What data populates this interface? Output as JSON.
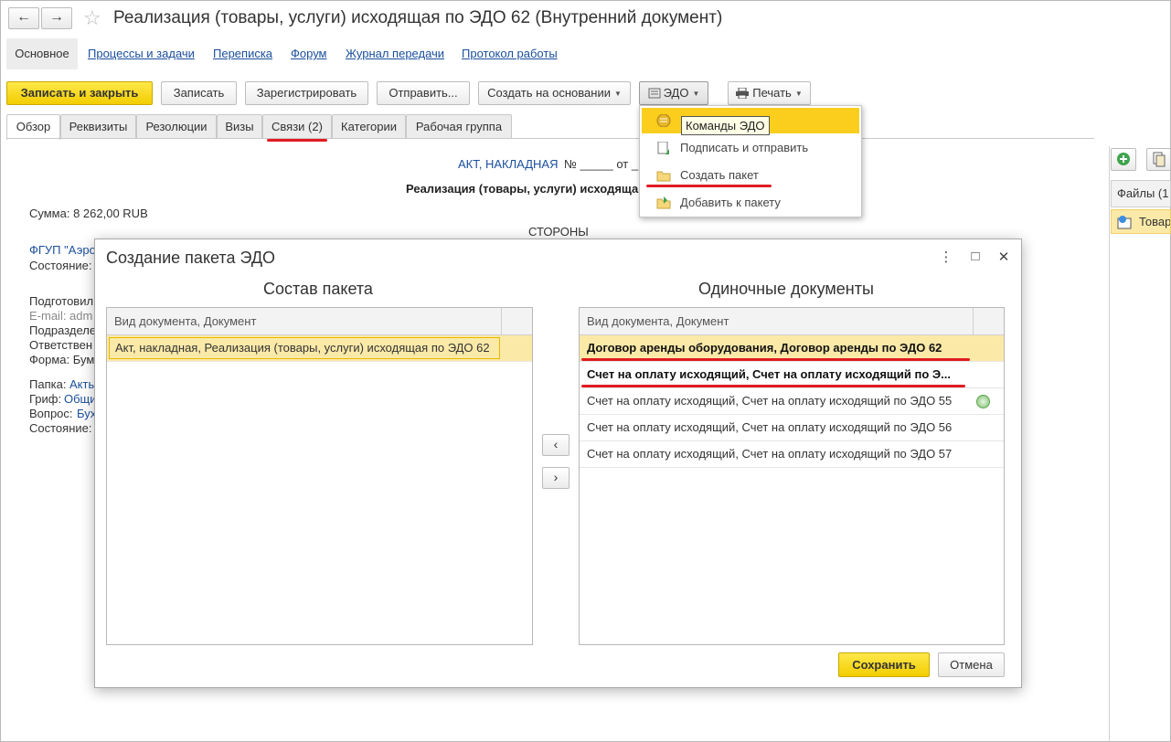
{
  "window": {
    "title": "Реализация (товары, услуги) исходящая по ЭДО 62 (Внутренний документ)",
    "back_icon": "←",
    "forward_icon": "→",
    "star_icon": "☆"
  },
  "sections": [
    "Основное",
    "Процессы и задачи",
    "Переписка",
    "Форум",
    "Журнал передачи",
    "Протокол работы"
  ],
  "toolbar": {
    "save_close": "Записать и закрыть",
    "save": "Записать",
    "register": "Зарегистрировать",
    "send": "Отправить...",
    "create_based": "Создать на основании",
    "edo": "ЭДО",
    "print": "Печать"
  },
  "tabs": [
    "Обзор",
    "Реквизиты",
    "Резолюции",
    "Визы",
    "Связи (2)",
    "Категории",
    "Рабочая группа"
  ],
  "edo_menu": {
    "items": [
      "Команды ЭДО",
      "Подписать и отправить",
      "Создать пакет",
      "Добавить к пакету"
    ],
    "tooltip": "Команды ЭДО"
  },
  "document": {
    "act_link": "АКТ, НАКЛАДНАЯ",
    "number_label": "№ _____ от _",
    "doc_name": "Реализация (товары, услуги) исходяща",
    "sum": "Сумма: 8 262,00 RUB",
    "parties_header": "СТОРОНЫ",
    "org_link": "ФГУП \"Аэро",
    "state_label": "Состояние: З",
    "prepared_label": "Подготовил",
    "email_label": "E-mail: adm",
    "department_label": "Подразделе",
    "responsible_label": "Ответствен",
    "form_label": "Форма: Бум",
    "folder_label": "Папка:",
    "folder_value": "Акты",
    "stamp_label": "Гриф:",
    "stamp_value": "Общи",
    "question_label": "Вопрос:",
    "question_value": "Бух",
    "status_label": "Состояние:"
  },
  "right_pane": {
    "files_header": "Файлы (1",
    "file_name": "Товар"
  },
  "dialog": {
    "title": "Создание пакета ЭДО",
    "menu_icon": "⋮",
    "maximize_icon": "□",
    "close_icon": "✕",
    "left_title": "Состав пакета",
    "right_title": "Одиночные документы",
    "column_header": "Вид документа, Документ",
    "package_rows": [
      "Акт, накладная, Реализация (товары, услуги) исходящая по ЭДО 62"
    ],
    "single_rows": [
      "Договор аренды оборудования, Договор аренды по ЭДО 62",
      "Счет на оплату исходящий, Счет на оплату исходящий по Э...",
      "Счет на оплату исходящий, Счет на оплату исходящий по ЭДО 55",
      "Счет на оплату исходящий, Счет на оплату исходящий по ЭДО 56",
      "Счет на оплату исходящий, Счет на оплату исходящий по ЭДО 57"
    ],
    "move_left": "‹",
    "move_right": "›",
    "save": "Сохранить",
    "cancel": "Отмена"
  },
  "colors": {
    "accent_yellow": "#fbce1e",
    "link_blue": "#1a4f9c",
    "highlight_row": "#fbe9a8",
    "underline_red": "#e11b22"
  }
}
